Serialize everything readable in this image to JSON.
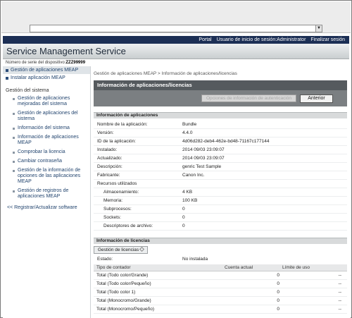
{
  "browser": {
    "menu_arrow": "▼"
  },
  "topnav": {
    "portal": "Portal",
    "login": "Usuario de inicio de sesión:Administrator",
    "logout": "Finalizar sesión"
  },
  "header": {
    "title": "Service Management Service",
    "serial_label": "Número de serie del dispositivo:",
    "serial_value": "ZZZ99999"
  },
  "sidebar": {
    "top_items": [
      {
        "label": "Gestión de aplicaciones MEAP"
      },
      {
        "label": "Instalar aplicación MEAP"
      }
    ],
    "group_label": "Gestión del sistema",
    "sub_items": [
      "Gestión de aplicaciones mejoradas del sistema",
      "Gestión de aplicaciones del sistema",
      "Información del sistema",
      "Información de aplicaciones MEAP",
      "Comprobar la licencia",
      "Cambiar contraseña",
      "Gestión de la información de opciones de las aplicaciones MEAP",
      "Gestión de registros de aplicaciones MEAP"
    ],
    "bottom_link": "<< Registrar/Actualizar software"
  },
  "main": {
    "breadcrumb": "Gestión de aplicaciones MEAP > Información de aplicaciones/licencias",
    "panel_title": "Información de aplicaciones/licencias",
    "auth_button": "Opciones de información de autenticación",
    "back_button": "Anterior",
    "app_section": "Información de aplicaciones",
    "app_rows": [
      {
        "label": "Nombre de la aplicación:",
        "value": "Bundle"
      },
      {
        "label": "Versión:",
        "value": "4.4.0"
      },
      {
        "label": "ID de la aplicación:",
        "value": "4d06d282-deb4-462e-bd48-71167c177144"
      },
      {
        "label": "Instalado:",
        "value": "2014 09/03 23:09:07"
      },
      {
        "label": "Actualizado:",
        "value": "2014 09/03 23:09:07"
      },
      {
        "label": "Descripción:",
        "value": "genric Test Sample"
      },
      {
        "label": "Fabricante:",
        "value": "Canon Inc."
      }
    ],
    "resources_label": "Recursos utilizados",
    "resource_rows": [
      {
        "label": "Almacenamiento:",
        "value": "4 KB"
      },
      {
        "label": "Memoria:",
        "value": "100 KB"
      },
      {
        "label": "Subprocesos:",
        "value": "0"
      },
      {
        "label": "Sockets:",
        "value": "0"
      },
      {
        "label": "Descriptores de archivo:",
        "value": "0"
      }
    ],
    "license_section": "Información de licencias",
    "license_tab": "Gestión de licencias",
    "status_label": "Estado:",
    "status_value": "No instalada",
    "table_headers": [
      "Tipo de contador",
      "Cuenta actual",
      "Límite de uso"
    ],
    "table_rows": [
      {
        "type": "Total (Todo color/Grande)",
        "count": "0",
        "limit": "--"
      },
      {
        "type": "Total (Todo color/Pequeño)",
        "count": "0",
        "limit": "--"
      },
      {
        "type": "Total (Todo color 1)",
        "count": "0",
        "limit": "--"
      },
      {
        "type": "Total (Monocromo/Grande)",
        "count": "0",
        "limit": "--"
      },
      {
        "type": "Total (Monocromo/Pequeño)",
        "count": "0",
        "limit": "--"
      }
    ]
  }
}
